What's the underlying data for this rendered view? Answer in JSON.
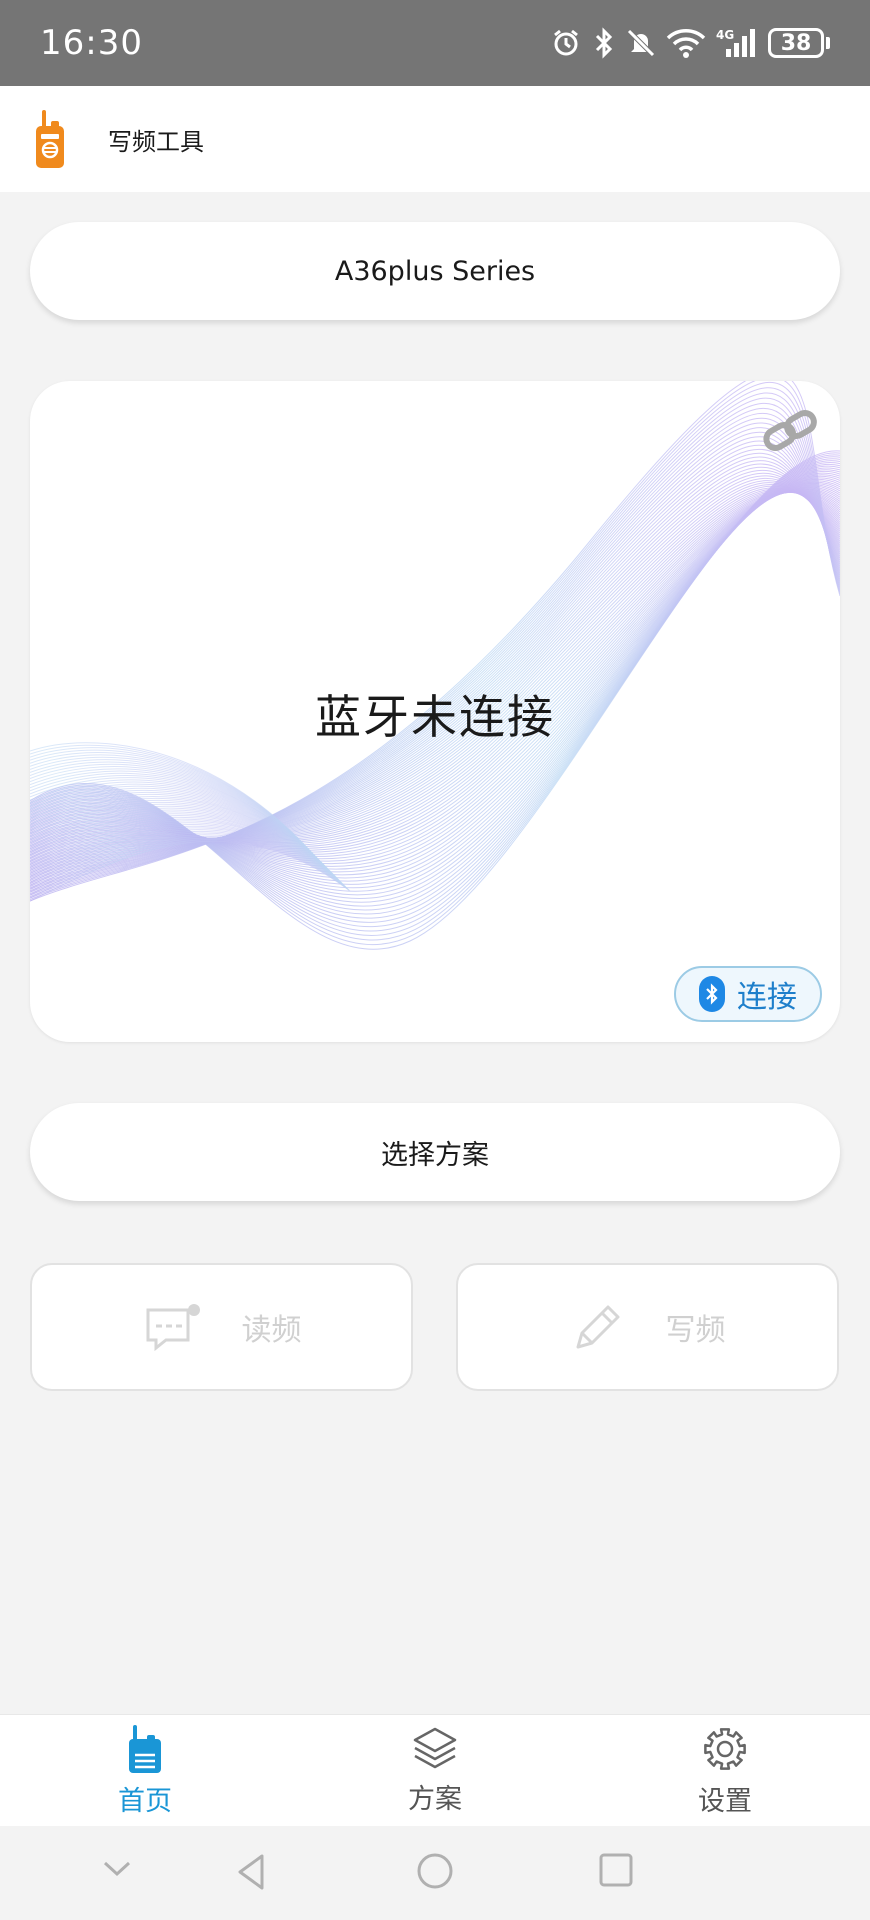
{
  "status_bar": {
    "time": "16:30",
    "network": "4G",
    "battery": "38"
  },
  "app_bar": {
    "title": "写频工具",
    "logo_icon": "walkie-talkie-icon"
  },
  "model_selector": {
    "label": "A36plus Series"
  },
  "bluetooth_card": {
    "status_text": "蓝牙未连接",
    "connect_label": "连接",
    "link_icon": "link-icon",
    "bluetooth_icon": "bluetooth-icon"
  },
  "scheme_selector": {
    "label": "选择方案"
  },
  "actions": {
    "read_label": "读频",
    "write_label": "写频"
  },
  "bottom_nav": {
    "items": [
      {
        "label": "首页",
        "icon": "walkie-talkie-icon",
        "active": true
      },
      {
        "label": "方案",
        "icon": "layers-icon",
        "active": false
      },
      {
        "label": "设置",
        "icon": "gear-icon",
        "active": false
      }
    ]
  },
  "colors": {
    "accent": "#1a96d6",
    "logo": "#f08a1d",
    "status_bar": "#757575",
    "background": "#f3f3f3"
  }
}
